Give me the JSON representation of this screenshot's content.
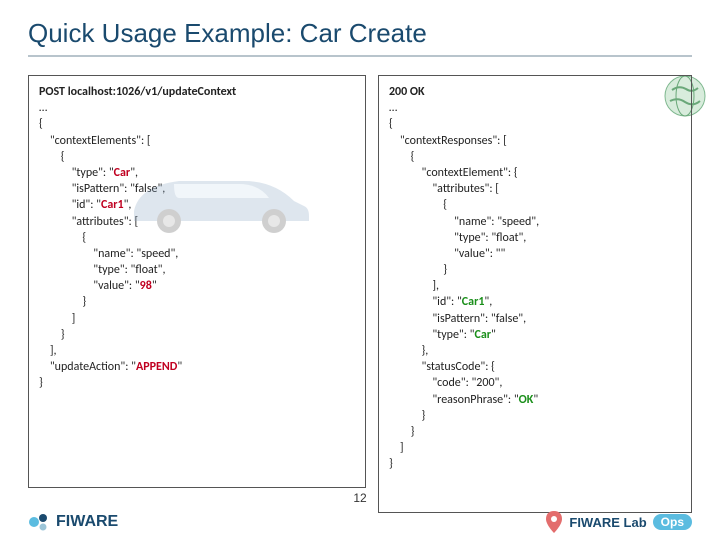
{
  "title": "Quick Usage Example: Car Create",
  "request": {
    "header": "POST localhost:1026/v1/updateContext",
    "ellipsis": "…",
    "open": "{",
    "ce_label": "\"contextElements\": [",
    "open2": "{",
    "type_line": "\"type\": \"",
    "type_val": "Car",
    "type_end": "\",",
    "isp_line": "\"isPattern\": \"false\",",
    "id_line": "\"id\": \"",
    "id_val": "Car1",
    "id_end": "\",",
    "attr_line": "\"attributes\": [",
    "open3": "{",
    "name_line": "\"name\": \"speed\",",
    "atype_line": "\"type\": \"float\",",
    "value_line": "\"value\": \"",
    "value_val": "98",
    "value_end": "\"",
    "close3": "}",
    "close_arr": "]",
    "close2": "}",
    "close_arr2": "],",
    "ua_line": "\"updateAction\": \"",
    "ua_val": "APPEND",
    "ua_end": "\"",
    "close": "}"
  },
  "response": {
    "status": "200 OK",
    "ellipsis": "…",
    "open": "{",
    "cr_label": "\"contextResponses\": [",
    "open2": "{",
    "ce_label": "\"contextElement\": {",
    "attr_line": "\"attributes\": [",
    "open3": "{",
    "name_line": "\"name\": \"speed\",",
    "type_line": "\"type\": \"float\",",
    "value_line": "\"value\": \"\"",
    "close3": "}",
    "close_arr": "],",
    "id_line": "\"id\": \"",
    "id_val": "Car1",
    "id_end": "\",",
    "isp_line": "\"isPattern\": \"false\",",
    "etype_line": "\"type\": \"",
    "etype_val": "Car",
    "etype_end": "\"",
    "close_ce": "},",
    "sc_label": "\"statusCode\": {",
    "code_line": "\"code\": \"200\",",
    "rp_line": "\"reasonPhrase\": \"",
    "rp_val": "OK",
    "rp_end": "\"",
    "close_sc": "}",
    "close2": "}",
    "close_arr2": "]",
    "close": "}"
  },
  "page_number": "12",
  "logo_text": "FIWARE",
  "lab_text": "FIWARE Lab",
  "ops_text": "Ops"
}
